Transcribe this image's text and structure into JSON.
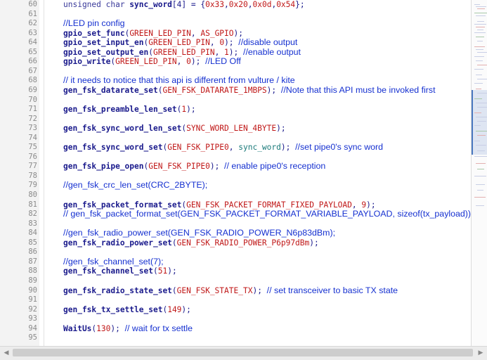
{
  "editor": {
    "lines": [
      {
        "num": "60",
        "tokens": [
          [
            "kw",
            "unsigned char "
          ],
          [
            "var-b",
            "sync_word"
          ],
          [
            "pun",
            "[4] = {"
          ],
          [
            "arg",
            "0x33"
          ],
          [
            "pun",
            ","
          ],
          [
            "arg",
            "0x20"
          ],
          [
            "pun",
            ","
          ],
          [
            "arg",
            "0x0d"
          ],
          [
            "pun",
            ","
          ],
          [
            "arg",
            "0x54"
          ],
          [
            "pun",
            "};"
          ]
        ]
      },
      {
        "num": "61",
        "tokens": []
      },
      {
        "num": "62",
        "tokens": [
          [
            "cm",
            "//LED pin config"
          ]
        ]
      },
      {
        "num": "63",
        "tokens": [
          [
            "fn",
            "gpio_set_func"
          ],
          [
            "pun",
            "("
          ],
          [
            "arg",
            "GREEN_LED_PIN"
          ],
          [
            "pun",
            ", "
          ],
          [
            "arg",
            "AS_GPIO"
          ],
          [
            "pun",
            ");"
          ]
        ]
      },
      {
        "num": "64",
        "tokens": [
          [
            "fn",
            "gpio_set_input_en"
          ],
          [
            "pun",
            "("
          ],
          [
            "arg",
            "GREEN_LED_PIN"
          ],
          [
            "pun",
            ", "
          ],
          [
            "arg",
            "0"
          ],
          [
            "pun",
            "); "
          ],
          [
            "cm",
            "//disable output"
          ]
        ]
      },
      {
        "num": "65",
        "tokens": [
          [
            "fn",
            "gpio_set_output_en"
          ],
          [
            "pun",
            "("
          ],
          [
            "arg",
            "GREEN_LED_PIN"
          ],
          [
            "pun",
            ", "
          ],
          [
            "arg",
            "1"
          ],
          [
            "pun",
            "); "
          ],
          [
            "cm",
            "//enable output"
          ]
        ]
      },
      {
        "num": "66",
        "tokens": [
          [
            "fn",
            "gpio_write"
          ],
          [
            "pun",
            "("
          ],
          [
            "arg",
            "GREEN_LED_PIN"
          ],
          [
            "pun",
            ", "
          ],
          [
            "arg",
            "0"
          ],
          [
            "pun",
            "); "
          ],
          [
            "cm",
            "//LED Off"
          ]
        ]
      },
      {
        "num": "67",
        "tokens": []
      },
      {
        "num": "68",
        "tokens": [
          [
            "cm",
            "// it needs to notice that this api is different from vulture / kite"
          ]
        ]
      },
      {
        "num": "69",
        "tokens": [
          [
            "fn",
            "gen_fsk_datarate_set"
          ],
          [
            "pun",
            "("
          ],
          [
            "arg",
            "GEN_FSK_DATARATE_1MBPS"
          ],
          [
            "pun",
            "); "
          ],
          [
            "cm",
            "//Note that this API must be invoked first"
          ]
        ]
      },
      {
        "num": "70",
        "tokens": []
      },
      {
        "num": "71",
        "tokens": [
          [
            "fn",
            "gen_fsk_preamble_len_set"
          ],
          [
            "pun",
            "("
          ],
          [
            "arg",
            "1"
          ],
          [
            "pun",
            ");"
          ]
        ]
      },
      {
        "num": "72",
        "tokens": []
      },
      {
        "num": "73",
        "tokens": [
          [
            "fn",
            "gen_fsk_sync_word_len_set"
          ],
          [
            "pun",
            "("
          ],
          [
            "arg",
            "SYNC_WORD_LEN_4BYTE"
          ],
          [
            "pun",
            ");"
          ]
        ]
      },
      {
        "num": "74",
        "tokens": []
      },
      {
        "num": "75",
        "tokens": [
          [
            "fn",
            "gen_fsk_sync_word_set"
          ],
          [
            "pun",
            "("
          ],
          [
            "arg",
            "GEN_FSK_PIPE0"
          ],
          [
            "pun",
            ", "
          ],
          [
            "var",
            "sync_word"
          ],
          [
            "pun",
            "); "
          ],
          [
            "cm",
            "//set pipe0's sync word"
          ]
        ]
      },
      {
        "num": "76",
        "tokens": []
      },
      {
        "num": "77",
        "tokens": [
          [
            "fn",
            "gen_fsk_pipe_open"
          ],
          [
            "pun",
            "("
          ],
          [
            "arg",
            "GEN_FSK_PIPE0"
          ],
          [
            "pun",
            "); "
          ],
          [
            "cm",
            "// enable pipe0's reception"
          ]
        ]
      },
      {
        "num": "78",
        "tokens": []
      },
      {
        "num": "79",
        "tokens": [
          [
            "cm",
            "//gen_fsk_crc_len_set(CRC_2BYTE);"
          ]
        ]
      },
      {
        "num": "80",
        "tokens": []
      },
      {
        "num": "81",
        "tokens": [
          [
            "fn",
            "gen_fsk_packet_format_set"
          ],
          [
            "pun",
            "("
          ],
          [
            "arg",
            "GEN_FSK_PACKET_FORMAT_FIXED_PAYLOAD"
          ],
          [
            "pun",
            ", "
          ],
          [
            "arg",
            "9"
          ],
          [
            "pun",
            ");"
          ]
        ]
      },
      {
        "num": "82",
        "tokens": [
          [
            "cm",
            "// gen_fsk_packet_format_set(GEN_FSK_PACKET_FORMAT_VARIABLE_PAYLOAD, sizeof(tx_payload));"
          ]
        ]
      },
      {
        "num": "83",
        "tokens": []
      },
      {
        "num": "84",
        "tokens": [
          [
            "cm",
            "//gen_fsk_radio_power_set(GEN_FSK_RADIO_POWER_N6p83dBm);"
          ]
        ]
      },
      {
        "num": "85",
        "tokens": [
          [
            "fn",
            "gen_fsk_radio_power_set"
          ],
          [
            "pun",
            "("
          ],
          [
            "arg",
            "GEN_FSK_RADIO_POWER_P6p97dBm"
          ],
          [
            "pun",
            ");"
          ]
        ]
      },
      {
        "num": "86",
        "tokens": []
      },
      {
        "num": "87",
        "tokens": [
          [
            "cm",
            "//gen_fsk_channel_set(7);"
          ]
        ]
      },
      {
        "num": "88",
        "tokens": [
          [
            "fn",
            "gen_fsk_channel_set"
          ],
          [
            "pun",
            "("
          ],
          [
            "arg",
            "51"
          ],
          [
            "pun",
            ");"
          ]
        ]
      },
      {
        "num": "89",
        "tokens": []
      },
      {
        "num": "90",
        "tokens": [
          [
            "fn",
            "gen_fsk_radio_state_set"
          ],
          [
            "pun",
            "("
          ],
          [
            "arg",
            "GEN_FSK_STATE_TX"
          ],
          [
            "pun",
            "); "
          ],
          [
            "cm",
            "// set transceiver to basic TX state"
          ]
        ]
      },
      {
        "num": "91",
        "tokens": []
      },
      {
        "num": "92",
        "tokens": [
          [
            "fn",
            "gen_fsk_tx_settle_set"
          ],
          [
            "pun",
            "("
          ],
          [
            "arg",
            "149"
          ],
          [
            "pun",
            ");"
          ]
        ]
      },
      {
        "num": "93",
        "tokens": []
      },
      {
        "num": "94",
        "tokens": [
          [
            "fn",
            "WaitUs"
          ],
          [
            "pun",
            "("
          ],
          [
            "arg",
            "130"
          ],
          [
            "pun",
            "); "
          ],
          [
            "cm",
            "// wait for tx settle"
          ]
        ]
      },
      {
        "num": "95",
        "tokens": []
      }
    ]
  },
  "scrollbar": {
    "left_arrow": "◀",
    "right_arrow": "▶",
    "horizontal_position": 0.0
  },
  "colors": {
    "function": "#1a1a8c",
    "argument": "#c01818",
    "comment": "#1530d0",
    "variable": "#1a7a7a"
  }
}
